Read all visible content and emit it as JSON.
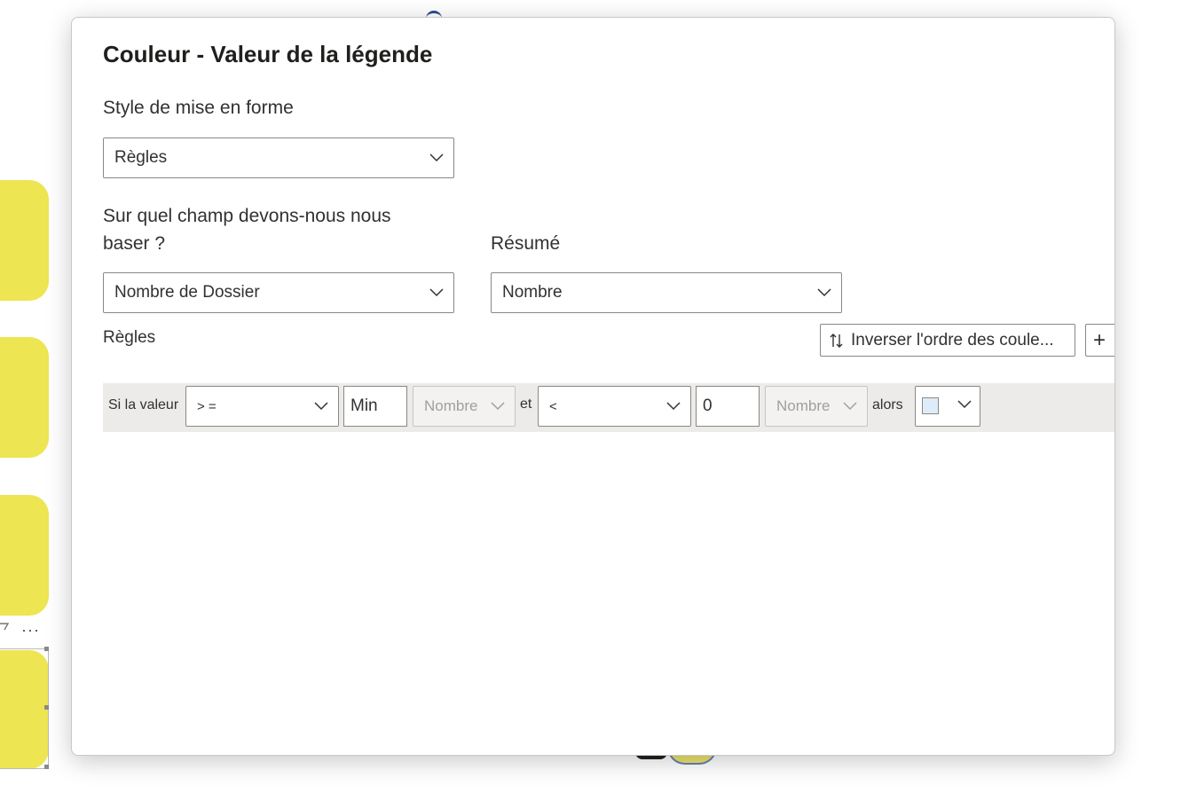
{
  "dialog": {
    "title": "Couleur - Valeur de la légende",
    "format_style": {
      "label": "Style de mise en forme",
      "value": "Règles"
    },
    "field": {
      "label_line1": "Sur quel champ devons-nous nous",
      "label_line2": "baser ?",
      "value": "Nombre de Dossier"
    },
    "summary": {
      "label": "Résumé",
      "value": "Nombre"
    },
    "rules": {
      "label": "Règles",
      "reverse_button": "Inverser l'ordre des coule...",
      "add_button": "+",
      "row": {
        "if_value": "Si la valeur",
        "op1": "> =",
        "value1": "Min",
        "type1": "Nombre",
        "and": "et",
        "op2": "<",
        "value2": "0",
        "type2": "Nombre",
        "then": "alors",
        "color": "#deecf9"
      }
    }
  },
  "background": {
    "tile_color": "#ede552",
    "more_dots": "···"
  }
}
